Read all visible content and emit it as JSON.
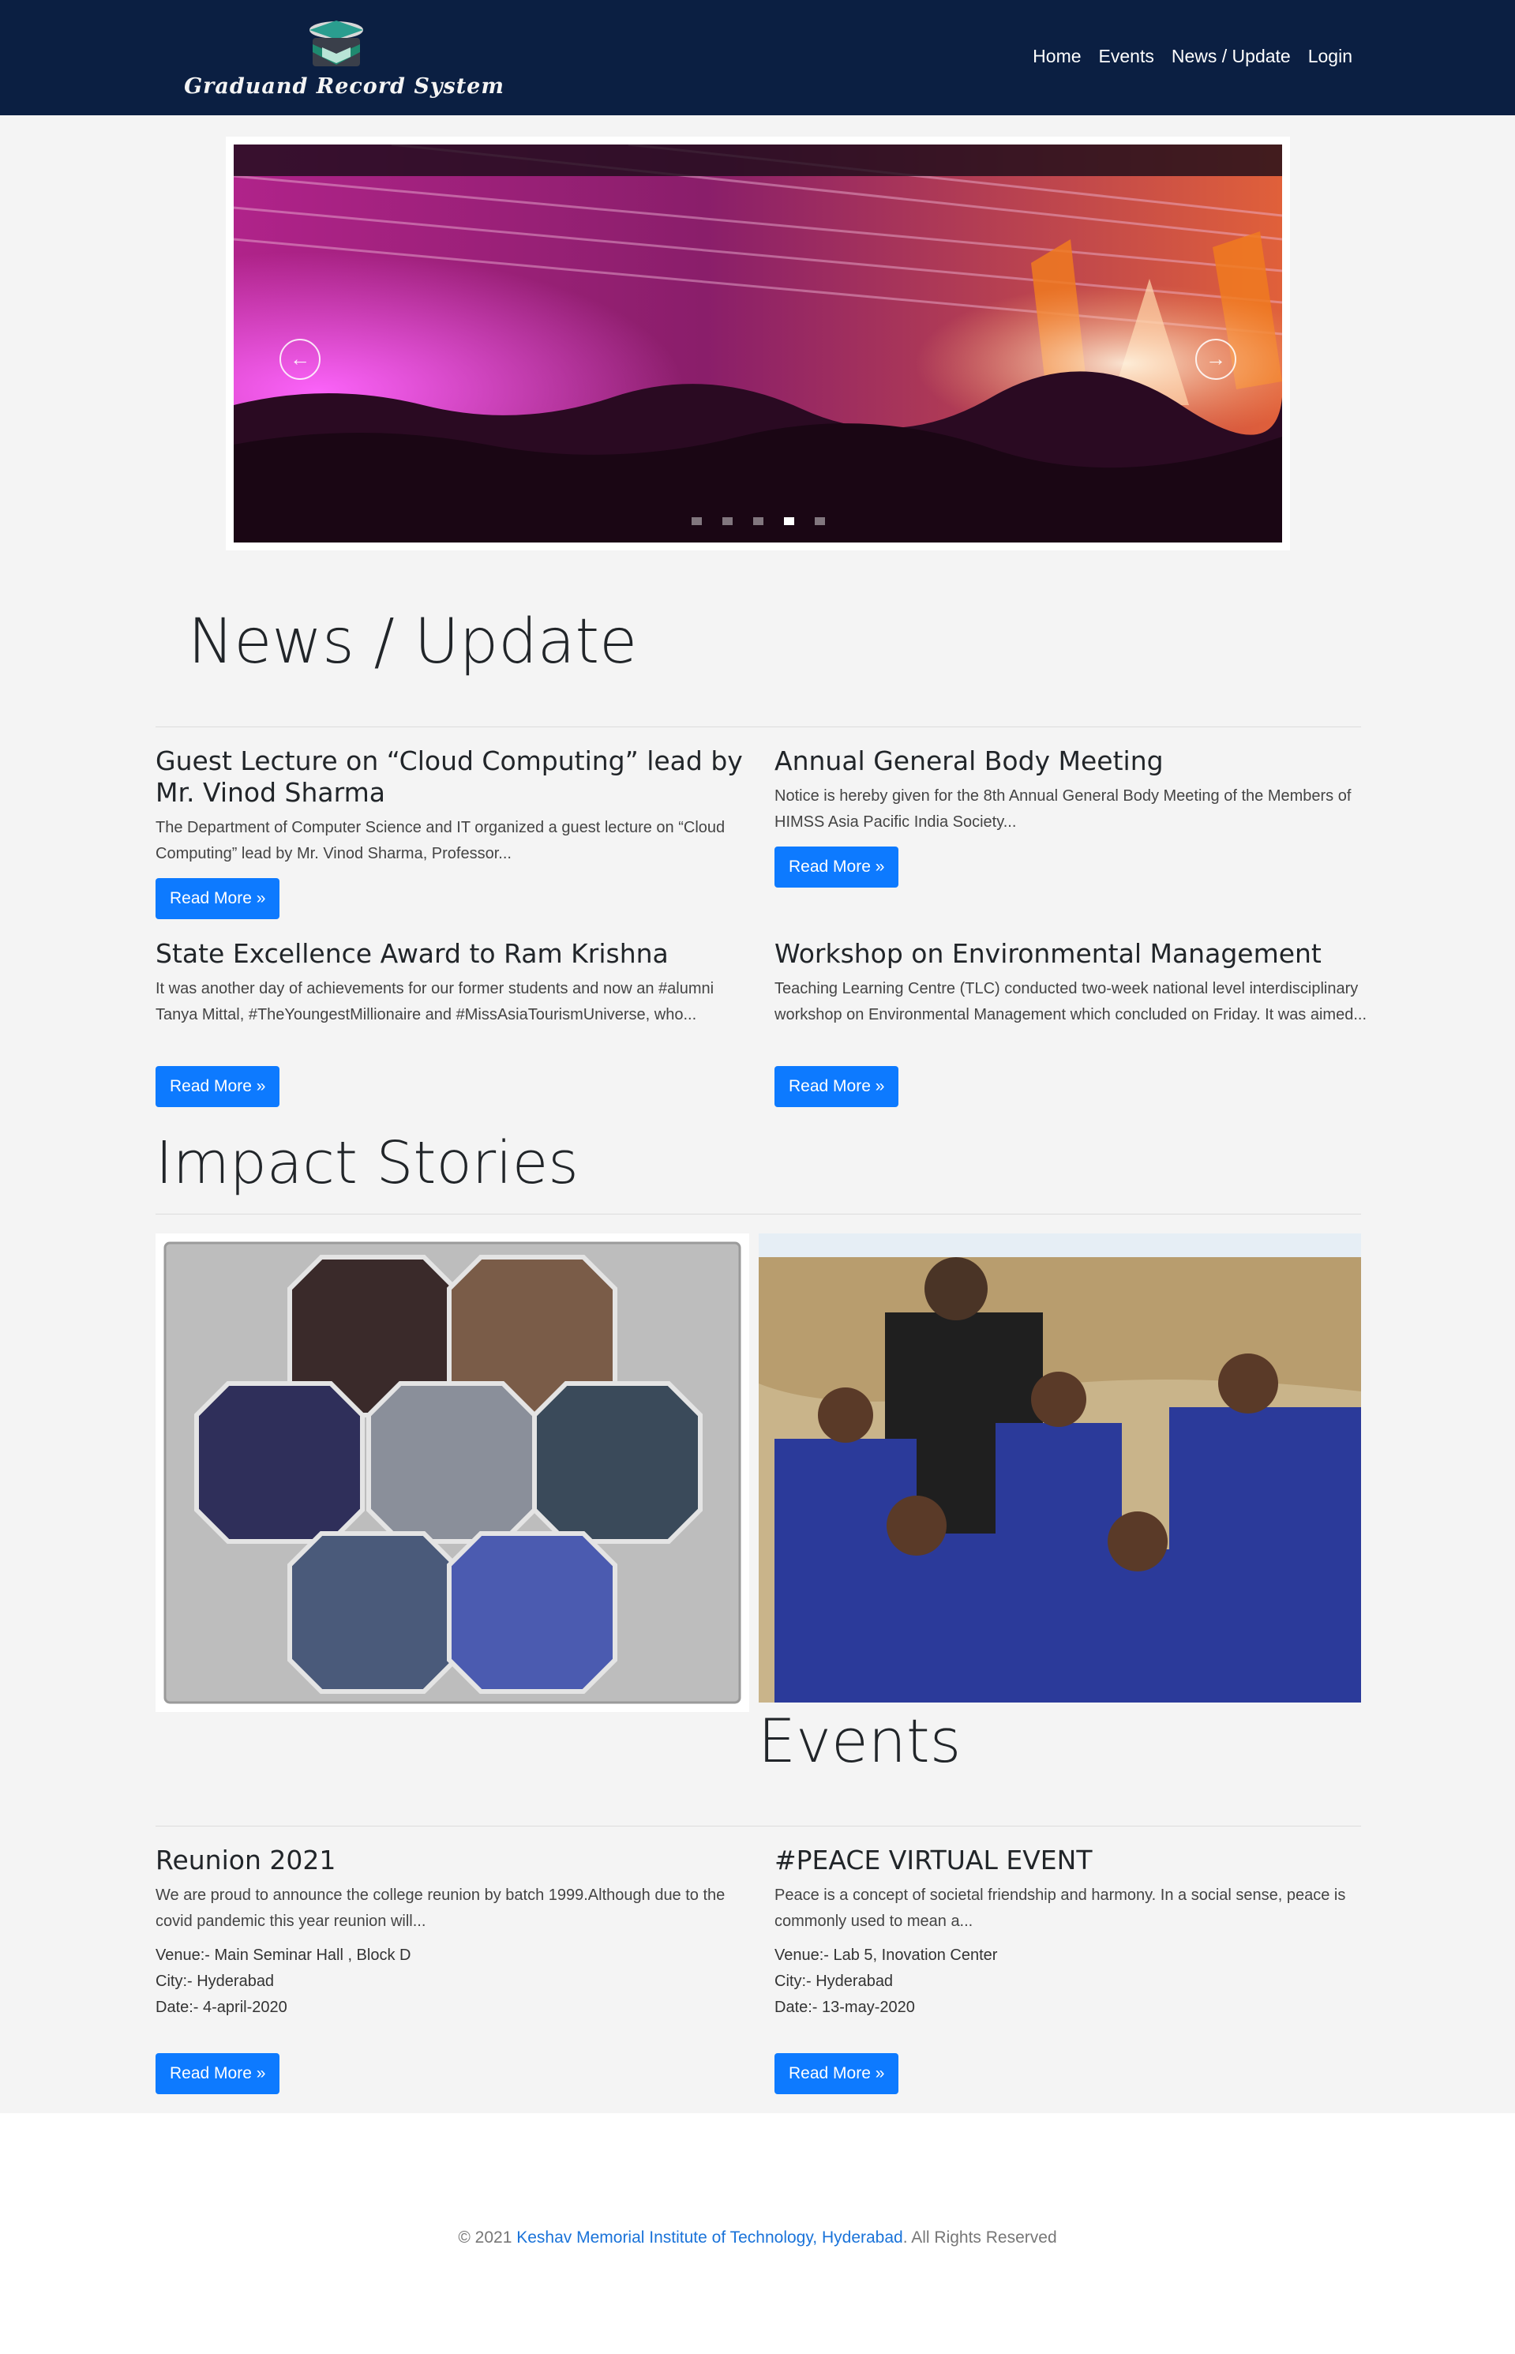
{
  "brand": {
    "name": "Graduand Record System",
    "logo_icon": "graduation-cap-book-icon"
  },
  "nav": {
    "items": [
      {
        "label": "Home"
      },
      {
        "label": "Events"
      },
      {
        "label": "News / Update"
      },
      {
        "label": "Login"
      }
    ]
  },
  "carousel": {
    "prev_icon": "arrow-left-icon",
    "next_icon": "arrow-right-icon",
    "slide_count": 5,
    "active_index": 3
  },
  "news": {
    "title": "News / Update",
    "items": [
      {
        "title": "Guest Lecture on “Cloud Computing” lead by Mr. Vinod Sharma",
        "summary": "The Department of Computer Science and IT organized a guest lecture on “Cloud Computing” lead by Mr. Vinod Sharma, Professor...",
        "button": "Read More »"
      },
      {
        "title": "Annual General Body Meeting",
        "summary": "Notice is hereby given for the 8th Annual General Body Meeting of the Members of HIMSS Asia Pacific India Society...",
        "button": "Read More »"
      },
      {
        "title": "State Excellence Award to Ram Krishna",
        "summary": "It was another day of achievements for our former students and now an #alumni Tanya Mittal, #TheYoungestMillionaire and #MissAsiaTourismUniverse, who...",
        "button": "Read More »"
      },
      {
        "title": "Workshop on Environmental Management",
        "summary": "Teaching Learning Centre (TLC) conducted two-week national level interdisciplinary workshop on Environmental Management which concluded on Friday. It was aimed...",
        "button": "Read More »"
      }
    ]
  },
  "impact": {
    "title": "Impact Stories"
  },
  "events": {
    "title": "Events",
    "items": [
      {
        "title": "Reunion 2021",
        "summary": "We are proud to announce the college reunion by batch 1999.Although due to the covid pandemic this year reunion will...",
        "venue": "Venue:- Main Seminar Hall , Block D",
        "city": "City:- Hyderabad",
        "date": "Date:- 4-april-2020",
        "button": "Read More »"
      },
      {
        "title": "#PEACE VIRTUAL EVENT",
        "summary": "Peace is a concept of societal friendship and harmony. In a social sense, peace is commonly used to mean a...",
        "venue": "Venue:- Lab 5, Inovation Center",
        "city": "City:- Hyderabad",
        "date": "Date:- 13-may-2020",
        "button": "Read More »"
      }
    ]
  },
  "footer": {
    "prefix": "© 2021 ",
    "link": "Keshav Memorial Institute of Technology, Hyderabad",
    "suffix": ". All Rights Reserved"
  },
  "colors": {
    "navbar": "#0b1f42",
    "button": "#0d7aff",
    "link": "#1a73d9",
    "background": "#f4f4f4"
  }
}
